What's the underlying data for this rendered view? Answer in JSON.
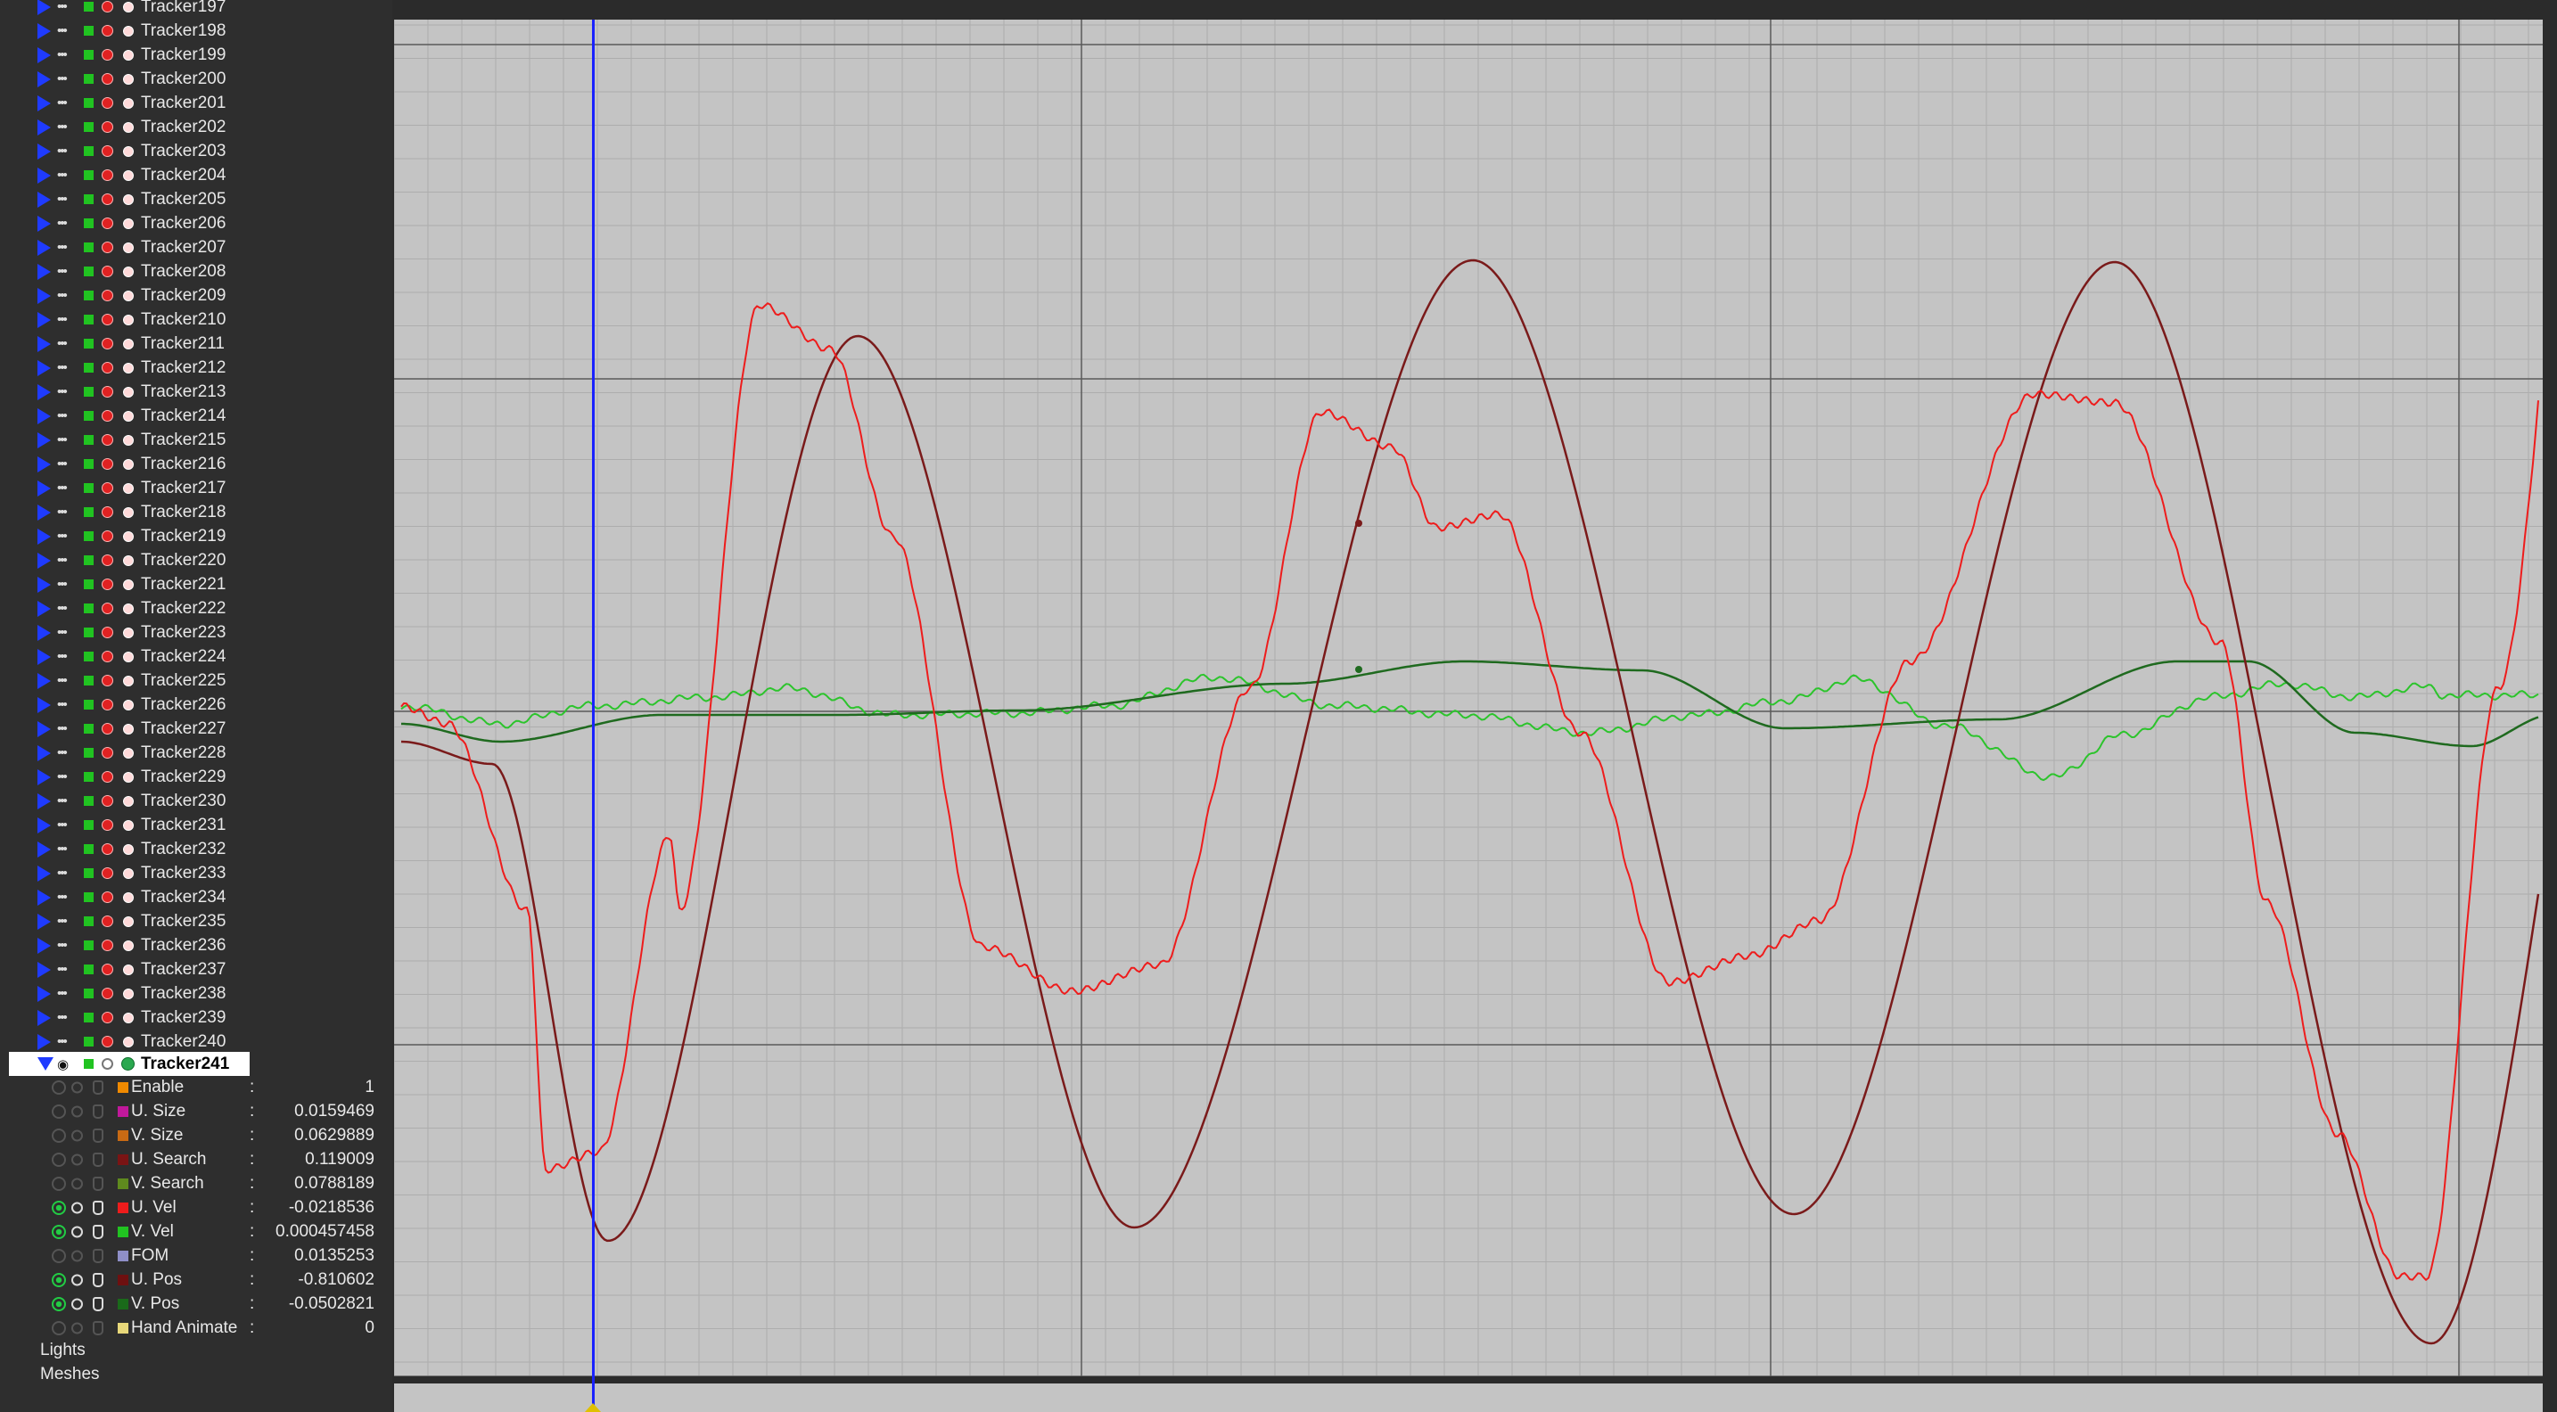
{
  "tree": {
    "trackers": [
      "Tracker197",
      "Tracker198",
      "Tracker199",
      "Tracker200",
      "Tracker201",
      "Tracker202",
      "Tracker203",
      "Tracker204",
      "Tracker205",
      "Tracker206",
      "Tracker207",
      "Tracker208",
      "Tracker209",
      "Tracker210",
      "Tracker211",
      "Tracker212",
      "Tracker213",
      "Tracker214",
      "Tracker215",
      "Tracker216",
      "Tracker217",
      "Tracker218",
      "Tracker219",
      "Tracker220",
      "Tracker221",
      "Tracker222",
      "Tracker223",
      "Tracker224",
      "Tracker225",
      "Tracker226",
      "Tracker227",
      "Tracker228",
      "Tracker229",
      "Tracker230",
      "Tracker231",
      "Tracker232",
      "Tracker233",
      "Tracker234",
      "Tracker235",
      "Tracker236",
      "Tracker237",
      "Tracker238",
      "Tracker239",
      "Tracker240"
    ],
    "selected": "Tracker241",
    "channels": [
      {
        "name": "Enable",
        "value": "1",
        "color": "#f08a00",
        "active": false
      },
      {
        "name": "U. Size",
        "value": "0.0159469",
        "color": "#c0189b",
        "active": false
      },
      {
        "name": "V. Size",
        "value": "0.0629889",
        "color": "#c86a14",
        "active": false
      },
      {
        "name": "U. Search",
        "value": "0.119009",
        "color": "#7a1414",
        "active": false
      },
      {
        "name": "V. Search",
        "value": "0.0788189",
        "color": "#5f8a1e",
        "active": false
      },
      {
        "name": "U. Vel",
        "value": "-0.0218536",
        "color": "#ee1c1c",
        "active": true
      },
      {
        "name": "V. Vel",
        "value": "0.000457458",
        "color": "#21c321",
        "active": true
      },
      {
        "name": "FOM",
        "value": "0.0135253",
        "color": "#8f8fc8",
        "active": false
      },
      {
        "name": "U. Pos",
        "value": "-0.810602",
        "color": "#6e1010",
        "active": true
      },
      {
        "name": "V. Pos",
        "value": "-0.0502821",
        "color": "#1a6a1a",
        "active": true
      },
      {
        "name": "Hand Animate",
        "value": "0",
        "color": "#e8d87a",
        "active": false
      }
    ],
    "groups": [
      "Lights",
      "Meshes"
    ],
    "colon": ":"
  },
  "graph": {
    "colors": {
      "background": "#c4c4c4",
      "u_vel": "#ee1c1c",
      "v_vel": "#2cc42c",
      "u_pos": "#7a1a1a",
      "v_pos": "#1f6a1f",
      "cursor": "#1a22ff"
    }
  }
}
